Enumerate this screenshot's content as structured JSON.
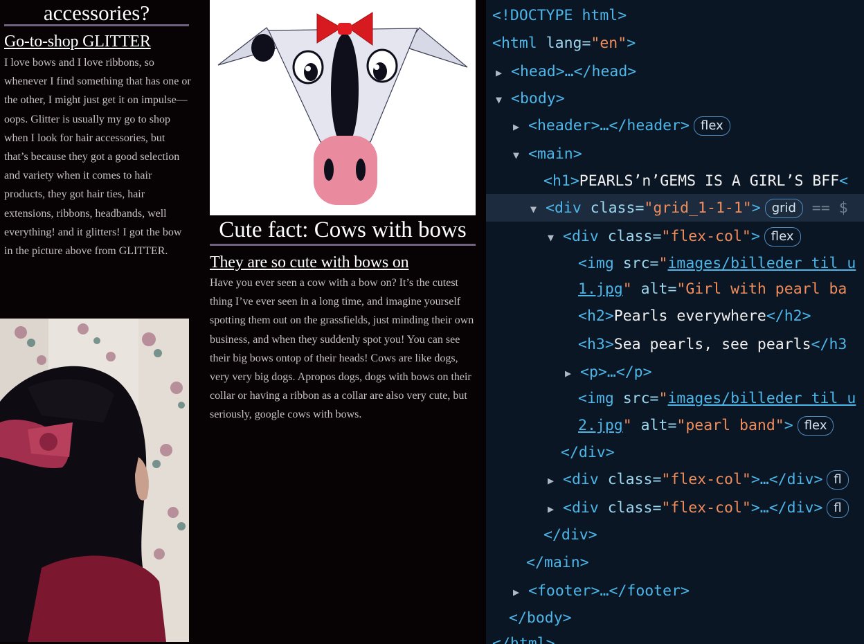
{
  "left_col": {
    "heading": "accessories?",
    "subheading": "Go-to-shop GLITTER",
    "paragraph": "I love bows and I love ribbons, so whenever I find something that has one or the other, I might just get it on impulse— oops. Glitter is usually my go to shop when I look for hair accessories, but that’s because they got a good selection and variety when it comes to hair products, they got hair ties, hair extensions, ribbons, headbands, well everything! and it glitters! I got the bow in the picture above from GLITTER."
  },
  "mid_col": {
    "heading": "Cute fact: Cows with bows",
    "subheading": "They are so cute with bows on",
    "paragraph": "Have you ever seen a cow with a bow on? It’s the cutest thing I’ve ever seen in a long time, and imagine yourself spotting them out on the grassfields, just minding their own business, and when they suddenly spot you! You can see their big bows ontop of their heads! Cows are like dogs, very very big dogs. Apropos dogs, dogs with bows on their collar or having a ribbon as a collar are also very cute, but seriously, google cows with bows."
  },
  "devtools": {
    "lines": {
      "doctype": "<!DOCTYPE html>",
      "html_open_tag": "<html",
      "html_lang_attr": " lang=",
      "html_lang_val": "\"en\"",
      "html_close_bracket": ">",
      "head": "<head>…</head>",
      "body_open": "<body>",
      "header": "<header>…</header>",
      "main_open": "<main>",
      "h1_open": "<h1>",
      "h1_text": "PEARLS’n’GEMS IS A GIRL’S BFF",
      "h1_close": "<",
      "div_open": "<div",
      "class_attr": " class=",
      "grid_val": "\"grid_1-1-1\"",
      "close_bracket": ">",
      "eq": "== $",
      "flexcol_val": "\"flex-col\"",
      "img_open": "<img",
      "src_attr": " src=",
      "src1_link": "images/billeder til u",
      "src1_end": "1.jpg",
      "alt_attr": " alt=",
      "alt1_val": "\"Girl with pearl ba",
      "h2_open": "<h2>",
      "h2_text": "Pearls everywhere",
      "h2_close": "</h2>",
      "h3_open": "<h3>",
      "h3_text": "Sea pearls, see pearls",
      "h3_close": "</h3",
      "p_line": "<p>…</p>",
      "src2_link": "images/billeder til u",
      "src2_end": "2.jpg",
      "alt2_val": "\"pearl band\"",
      "div_close": "</div>",
      "collapsed_div_end": ">…</div>",
      "main_close": "</main>",
      "footer": "<footer>…</footer>",
      "body_close": "</body>",
      "html_close": "</html>"
    },
    "badges": {
      "flex": "flex",
      "grid": "grid",
      "fl": "fl"
    },
    "quote_open": "\"",
    "quote_close": "\""
  },
  "colors": {
    "tag": "#4db6e8",
    "attribute": "#9cd8ef",
    "value": "#f08d5b",
    "text": "#f0f0f0",
    "devtools_bg": "#0b1625",
    "page_bg": "#070304",
    "underline_bar": "#6f6280"
  },
  "icons": [
    "expand-arrow-icon",
    "collapse-arrow-icon"
  ]
}
